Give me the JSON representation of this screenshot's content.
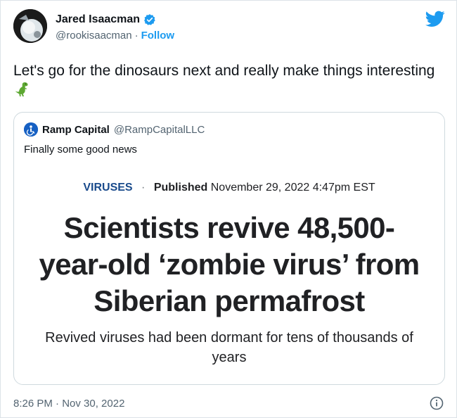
{
  "author": {
    "display_name": "Jared Isaacman",
    "handle": "@rookisaacman",
    "separator": "·",
    "follow_label": "Follow"
  },
  "tweet": {
    "text": "Let's go for the dinosaurs next and really make things interesting",
    "timestamp": "8:26 PM · Nov 30, 2022"
  },
  "quoted_tweet": {
    "display_name": "Ramp Capital",
    "handle": "@RampCapitalLLC",
    "text": "Finally some good news",
    "article": {
      "category": "VIRUSES",
      "separator": "·",
      "published_label": "Published",
      "published_date": "November 29, 2022 4:47pm EST",
      "headline": "Scientists revive 48,500-year-old ‘zombie virus’ from Siberian permafrost",
      "subhead": "Revived viruses had been dormant for tens of thousands of years"
    }
  },
  "icons": {
    "verified": "verified-badge-icon",
    "brand": "twitter-bird-icon",
    "emoji": "t-rex-emoji-icon",
    "info": "info-icon"
  },
  "colors": {
    "twitter_blue": "#1d9bf0",
    "category_blue": "#1a4b8c",
    "secondary_text": "#536471"
  }
}
